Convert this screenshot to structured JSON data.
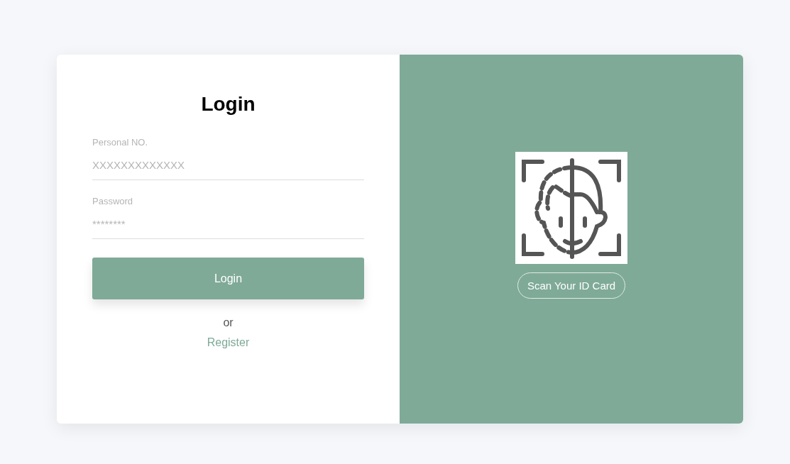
{
  "login_form": {
    "title": "Login",
    "fields": [
      {
        "label": "Personal NO.",
        "placeholder": "XXXXXXXXXXXXX"
      },
      {
        "label": "Password",
        "placeholder": "********"
      }
    ],
    "submit_button": "Login",
    "separator": "or",
    "register_link": "Register"
  },
  "scan_panel": {
    "button": "Scan Your ID Card"
  }
}
